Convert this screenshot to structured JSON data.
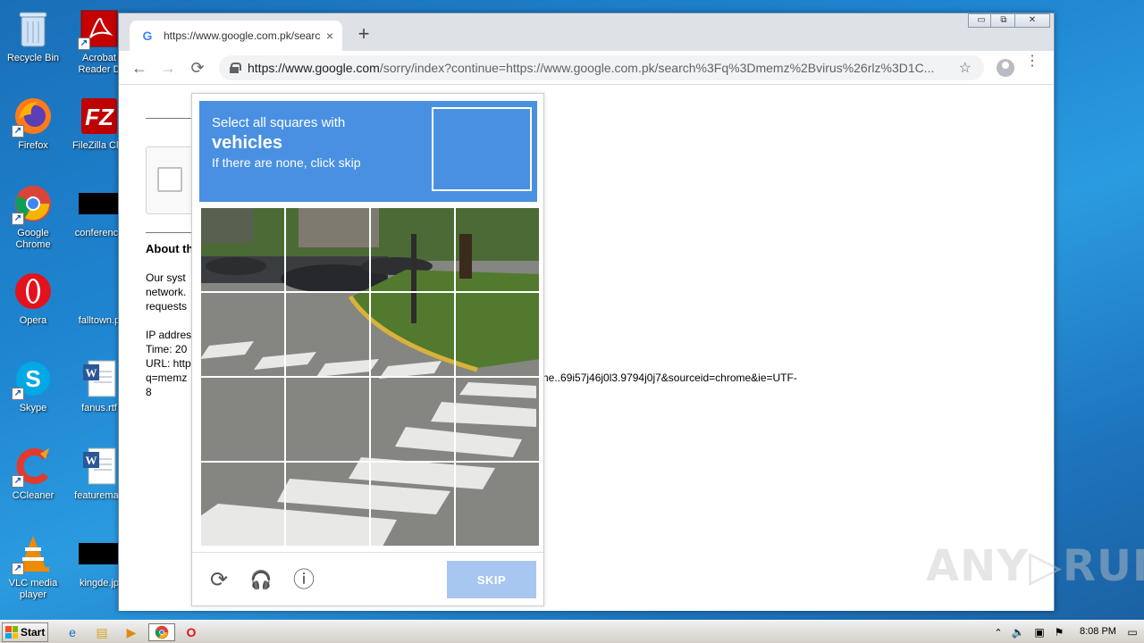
{
  "desktop": {
    "icons": [
      {
        "label": "Recycle Bin"
      },
      {
        "label": "Acrobat Reader D"
      },
      {
        "label": "Firefox"
      },
      {
        "label": "FileZilla Clie"
      },
      {
        "label": "Google Chrome"
      },
      {
        "label": "conference"
      },
      {
        "label": "Opera"
      },
      {
        "label": "falltown.p"
      },
      {
        "label": "Skype"
      },
      {
        "label": "fanus.rtf"
      },
      {
        "label": "CCleaner"
      },
      {
        "label": "featuremap"
      },
      {
        "label": "VLC media player"
      },
      {
        "label": "kingde.jp"
      }
    ]
  },
  "browser": {
    "tab_title": "https://www.google.com.pk/search?",
    "tab_close": "×",
    "new_tab": "+",
    "url_host": "https://www.google.com",
    "url_rest": "/sorry/index?continue=https://www.google.com.pk/search%3Fq%3Dmemz%2Bvirus%26rlz%3D1C...",
    "back": "←",
    "forward": "→",
    "reload": "⟳",
    "star": "☆",
    "menu": "⋮",
    "win_minimize": "▭",
    "win_restore": "⧉",
    "win_close": "✕"
  },
  "page": {
    "about_heading": "About th",
    "para_line1": "Our syst",
    "para_line2": "network.",
    "para_line3": "requests",
    "ip_line": "IP addres",
    "time_line": "Time: 20",
    "url_line": "URL: http",
    "q_line": "q=memz",
    "q_line_tail": "ne..69i57j46j0l3.9794j0j7&sourceid=chrome&ie=UTF-",
    "last_line": "8"
  },
  "captcha": {
    "instruction_line1": "Select all squares with",
    "instruction_target": "vehicles",
    "instruction_line3": "If there are none, click skip",
    "skip_label": "SKIP",
    "reload_icon": "⟳",
    "audio_icon": "🎧",
    "info_icon": "ⓘ",
    "tiles": 16
  },
  "watermark": "ANY▷RUN",
  "taskbar": {
    "start_label": "Start",
    "clock": "8:08 PM"
  }
}
